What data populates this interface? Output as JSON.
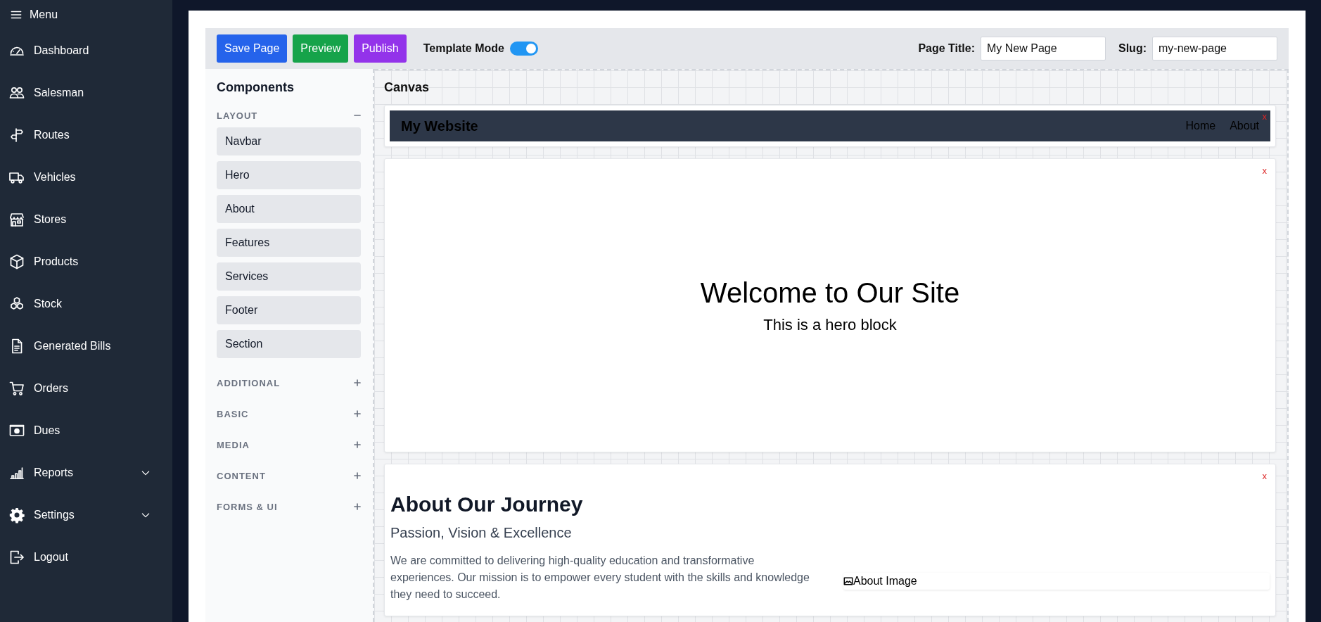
{
  "sidebar": {
    "menu_label": "Menu",
    "items": [
      {
        "label": "Dashboard",
        "expandable": false
      },
      {
        "label": "Salesman",
        "expandable": false
      },
      {
        "label": "Routes",
        "expandable": false
      },
      {
        "label": "Vehicles",
        "expandable": false
      },
      {
        "label": "Stores",
        "expandable": false
      },
      {
        "label": "Products",
        "expandable": false
      },
      {
        "label": "Stock",
        "expandable": false
      },
      {
        "label": "Generated Bills",
        "expandable": false
      },
      {
        "label": "Orders",
        "expandable": false
      },
      {
        "label": "Dues",
        "expandable": false
      },
      {
        "label": "Reports",
        "expandable": true
      },
      {
        "label": "Settings",
        "expandable": true
      },
      {
        "label": "Logout",
        "expandable": false
      }
    ]
  },
  "toolbar": {
    "buttons": [
      {
        "label": "Save Page",
        "color": "#2563eb"
      },
      {
        "label": "Preview",
        "color": "#16a34a"
      },
      {
        "label": "Publish",
        "color": "#9333ea"
      }
    ],
    "template_mode": {
      "label": "Template Mode",
      "on": true
    },
    "page_title": {
      "label": "Page Title:",
      "value": "My New Page"
    },
    "slug": {
      "label": "Slug:",
      "value": "my-new-page"
    }
  },
  "components": {
    "title": "Components",
    "groups": [
      {
        "label": "LAYOUT",
        "expanded": true,
        "items": [
          "Navbar",
          "Hero",
          "About",
          "Features",
          "Services",
          "Footer",
          "Section"
        ]
      },
      {
        "label": "ADDITIONAL",
        "expanded": false
      },
      {
        "label": "BASIC",
        "expanded": false
      },
      {
        "label": "MEDIA",
        "expanded": false
      },
      {
        "label": "CONTENT",
        "expanded": false
      },
      {
        "label": "FORMS & UI",
        "expanded": false
      }
    ]
  },
  "canvas": {
    "title": "Canvas",
    "blocks": [
      {
        "kind": "navbar",
        "brand": "My Website",
        "links": [
          "Home",
          "About"
        ],
        "remove": "x"
      },
      {
        "kind": "hero",
        "heading": "Welcome to Our Site",
        "subheading": "This is a hero block",
        "remove": "x"
      },
      {
        "kind": "about",
        "heading": "About Our Journey",
        "subheading": "Passion, Vision & Excellence",
        "text": "We are committed to delivering high-quality education and transformative experiences. Our mission is to empower every student with the skills and knowledge they need to succeed.",
        "image_alt": "About Image",
        "remove": "x"
      }
    ]
  }
}
